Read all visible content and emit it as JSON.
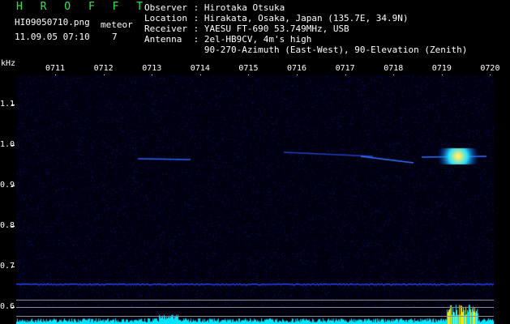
{
  "app": {
    "name": "H R O F F T"
  },
  "file": {
    "name": "HI09050710.png",
    "datetime": "11.09.05 07:10"
  },
  "meteor": {
    "label": "meteor",
    "count": "7"
  },
  "info": [
    {
      "key": "Observer",
      "value": "Hirotaka Otsuka"
    },
    {
      "key": "Location",
      "value": "Hirakata, Osaka, Japan (135.7E, 34.9N)"
    },
    {
      "key": "Receiver",
      "value": "YAESU FT-690 53.749MHz, USB"
    },
    {
      "key": "Antenna",
      "value": "2el-HB9CV, 4m's high"
    },
    {
      "key": "",
      "value": "90-270-Azimuth (East-West), 90-Elevation (Zenith)"
    }
  ],
  "axis": {
    "y_unit": "kHz",
    "y_ticks": [
      "1.1",
      "1.0",
      "0.9",
      "0.8",
      "0.7",
      "0.6"
    ],
    "x_ticks": [
      "0711",
      "0712",
      "0713",
      "0714",
      "0715",
      "0716",
      "0717",
      "0718",
      "0719",
      "0720"
    ]
  },
  "colors": {
    "background": "#000000",
    "title": "#2fe84a",
    "signal": "#2040ff",
    "peak": "#ffe600",
    "level": "#00e5ff"
  }
}
